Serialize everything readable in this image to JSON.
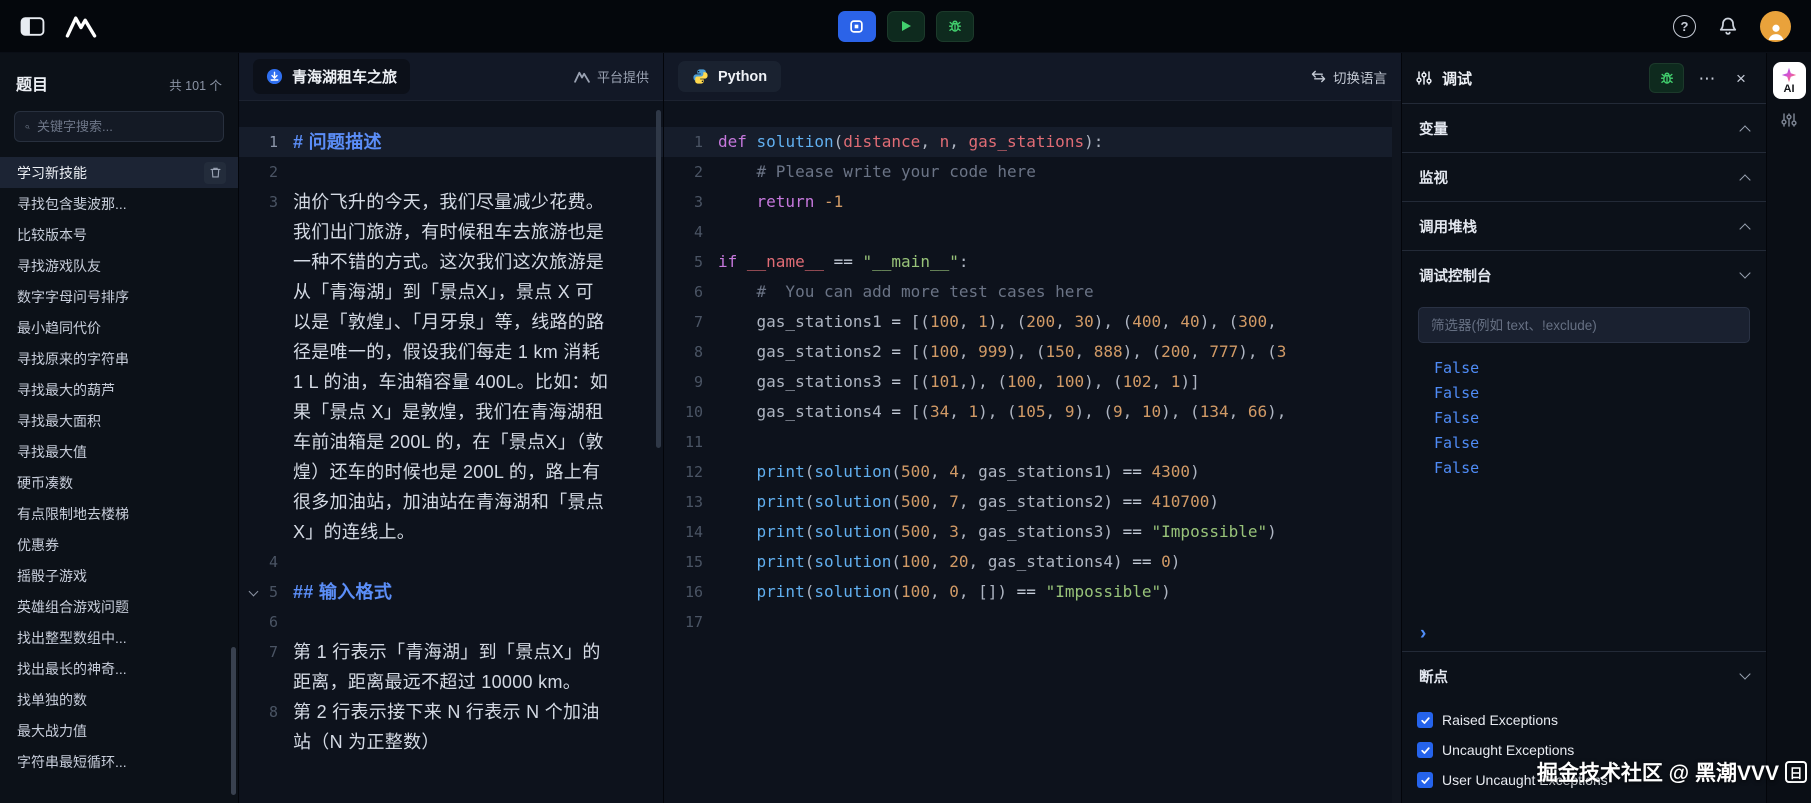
{
  "topbar": {
    "help": "?"
  },
  "sidebar": {
    "title": "题目",
    "count": "共 101 个",
    "search_placeholder": "关键字搜索...",
    "items": [
      {
        "label": "学习新技能",
        "active": true
      },
      {
        "label": "寻找包含斐波那..."
      },
      {
        "label": "比较版本号"
      },
      {
        "label": "寻找游戏队友"
      },
      {
        "label": "数字字母问号排序"
      },
      {
        "label": "最小趋同代价"
      },
      {
        "label": "寻找原来的字符串"
      },
      {
        "label": "寻找最大的葫芦"
      },
      {
        "label": "寻找最大面积"
      },
      {
        "label": "寻找最大值"
      },
      {
        "label": "硬币凑数"
      },
      {
        "label": "有点限制地去楼梯"
      },
      {
        "label": "优惠券"
      },
      {
        "label": "摇骰子游戏"
      },
      {
        "label": "英雄组合游戏问题"
      },
      {
        "label": "找出整型数组中..."
      },
      {
        "label": "找出最长的神奇..."
      },
      {
        "label": "找单独的数"
      },
      {
        "label": "最大战力值"
      },
      {
        "label": "字符串最短循环..."
      }
    ]
  },
  "problem": {
    "title": "青海湖租车之旅",
    "provider": "平台提供",
    "lines": [
      {
        "n": "1",
        "style": "heading",
        "highlight": true,
        "text": "# 问题描述"
      },
      {
        "n": "2",
        "style": "blank",
        "text": ""
      },
      {
        "n": "3",
        "style": "text",
        "text": "油价飞升的今天，我们尽量减少花费。我们出门旅游，有时候租车去旅游也是一种不错的方式。这次我们这次旅游是从「青海湖」到「景点X」，景点 X 可以是「敦煌」、「月牙泉」等，线路的路径是唯一的，假设我们每走 1 km 消耗 1 L 的油，车油箱容量 400L。比如：如果「景点 X」是敦煌，我们在青海湖租车前油箱是 200L 的，在「景点X」（敦煌）还车的时候也是 200L 的，路上有很多加油站，加油站在青海湖和「景点 X」的连线上。"
      },
      {
        "n": "4",
        "style": "blank",
        "text": ""
      },
      {
        "n": "5",
        "style": "heading",
        "chevron": true,
        "text": "## 输入格式"
      },
      {
        "n": "6",
        "style": "blank",
        "text": ""
      },
      {
        "n": "7",
        "style": "text",
        "text": "第 1 行表示「青海湖」到「景点X」的距离，距离最远不超过 10000 km。"
      },
      {
        "n": "8",
        "style": "text",
        "text": "第 2 行表示接下来 N 行表示 N 个加油站（N 为正整数）"
      }
    ]
  },
  "editor": {
    "language": "Python",
    "switch_label": "切换语言",
    "lines": [
      {
        "n": "1",
        "highlight": true,
        "tokens": [
          [
            "k",
            "def"
          ],
          [
            "t",
            " "
          ],
          [
            "f",
            "solution"
          ],
          [
            "t",
            "("
          ],
          [
            "p",
            "distance"
          ],
          [
            "t",
            ", "
          ],
          [
            "p",
            "n"
          ],
          [
            "t",
            ", "
          ],
          [
            "p",
            "gas_stations"
          ],
          [
            "t",
            "):"
          ]
        ]
      },
      {
        "n": "2",
        "tokens": [
          [
            "c",
            "    # Please write your code here"
          ]
        ]
      },
      {
        "n": "3",
        "tokens": [
          [
            "t",
            "    "
          ],
          [
            "k",
            "return"
          ],
          [
            "t",
            " "
          ],
          [
            "n",
            "-1"
          ]
        ]
      },
      {
        "n": "4",
        "tokens": []
      },
      {
        "n": "5",
        "tokens": [
          [
            "k",
            "if"
          ],
          [
            "t",
            " "
          ],
          [
            "p",
            "__name__"
          ],
          [
            "t",
            " "
          ],
          [
            "o",
            "=="
          ],
          [
            "t",
            " "
          ],
          [
            "s",
            "\"__main__\""
          ],
          [
            "t",
            ":"
          ]
        ]
      },
      {
        "n": "6",
        "tokens": [
          [
            "c",
            "    #  You can add more test cases here"
          ]
        ]
      },
      {
        "n": "7",
        "tokens": [
          [
            "t",
            "    gas_stations1 "
          ],
          [
            "o",
            "="
          ],
          [
            "t",
            " [("
          ],
          [
            "n",
            "100"
          ],
          [
            "t",
            ", "
          ],
          [
            "n",
            "1"
          ],
          [
            "t",
            "), ("
          ],
          [
            "n",
            "200"
          ],
          [
            "t",
            ", "
          ],
          [
            "n",
            "30"
          ],
          [
            "t",
            "), ("
          ],
          [
            "n",
            "400"
          ],
          [
            "t",
            ", "
          ],
          [
            "n",
            "40"
          ],
          [
            "t",
            "), ("
          ],
          [
            "n",
            "300"
          ],
          [
            "t",
            ","
          ]
        ]
      },
      {
        "n": "8",
        "tokens": [
          [
            "t",
            "    gas_stations2 "
          ],
          [
            "o",
            "="
          ],
          [
            "t",
            " [("
          ],
          [
            "n",
            "100"
          ],
          [
            "t",
            ", "
          ],
          [
            "n",
            "999"
          ],
          [
            "t",
            "), ("
          ],
          [
            "n",
            "150"
          ],
          [
            "t",
            ", "
          ],
          [
            "n",
            "888"
          ],
          [
            "t",
            "), ("
          ],
          [
            "n",
            "200"
          ],
          [
            "t",
            ", "
          ],
          [
            "n",
            "777"
          ],
          [
            "t",
            "), ("
          ],
          [
            "n",
            "3"
          ]
        ]
      },
      {
        "n": "9",
        "tokens": [
          [
            "t",
            "    gas_stations3 "
          ],
          [
            "o",
            "="
          ],
          [
            "t",
            " [("
          ],
          [
            "n",
            "101"
          ],
          [
            "t",
            ",), ("
          ],
          [
            "n",
            "100"
          ],
          [
            "t",
            ", "
          ],
          [
            "n",
            "100"
          ],
          [
            "t",
            "), ("
          ],
          [
            "n",
            "102"
          ],
          [
            "t",
            ", "
          ],
          [
            "n",
            "1"
          ],
          [
            "t",
            ")]"
          ]
        ]
      },
      {
        "n": "10",
        "tokens": [
          [
            "t",
            "    gas_stations4 "
          ],
          [
            "o",
            "="
          ],
          [
            "t",
            " [("
          ],
          [
            "n",
            "34"
          ],
          [
            "t",
            ", "
          ],
          [
            "n",
            "1"
          ],
          [
            "t",
            "), ("
          ],
          [
            "n",
            "105"
          ],
          [
            "t",
            ", "
          ],
          [
            "n",
            "9"
          ],
          [
            "t",
            "), ("
          ],
          [
            "n",
            "9"
          ],
          [
            "t",
            ", "
          ],
          [
            "n",
            "10"
          ],
          [
            "t",
            "), ("
          ],
          [
            "n",
            "134"
          ],
          [
            "t",
            ", "
          ],
          [
            "n",
            "66"
          ],
          [
            "t",
            "),"
          ]
        ]
      },
      {
        "n": "11",
        "tokens": []
      },
      {
        "n": "12",
        "tokens": [
          [
            "t",
            "    "
          ],
          [
            "f",
            "print"
          ],
          [
            "t",
            "("
          ],
          [
            "f",
            "solution"
          ],
          [
            "t",
            "("
          ],
          [
            "n",
            "500"
          ],
          [
            "t",
            ", "
          ],
          [
            "n",
            "4"
          ],
          [
            "t",
            ", gas_stations1) "
          ],
          [
            "o",
            "=="
          ],
          [
            "t",
            " "
          ],
          [
            "n",
            "4300"
          ],
          [
            "t",
            ")"
          ]
        ]
      },
      {
        "n": "13",
        "tokens": [
          [
            "t",
            "    "
          ],
          [
            "f",
            "print"
          ],
          [
            "t",
            "("
          ],
          [
            "f",
            "solution"
          ],
          [
            "t",
            "("
          ],
          [
            "n",
            "500"
          ],
          [
            "t",
            ", "
          ],
          [
            "n",
            "7"
          ],
          [
            "t",
            ", gas_stations2) "
          ],
          [
            "o",
            "=="
          ],
          [
            "t",
            " "
          ],
          [
            "n",
            "410700"
          ],
          [
            "t",
            ")"
          ]
        ]
      },
      {
        "n": "14",
        "tokens": [
          [
            "t",
            "    "
          ],
          [
            "f",
            "print"
          ],
          [
            "t",
            "("
          ],
          [
            "f",
            "solution"
          ],
          [
            "t",
            "("
          ],
          [
            "n",
            "500"
          ],
          [
            "t",
            ", "
          ],
          [
            "n",
            "3"
          ],
          [
            "t",
            ", gas_stations3) "
          ],
          [
            "o",
            "=="
          ],
          [
            "t",
            " "
          ],
          [
            "s",
            "\"Impossible\""
          ],
          [
            "t",
            ")"
          ]
        ]
      },
      {
        "n": "15",
        "tokens": [
          [
            "t",
            "    "
          ],
          [
            "f",
            "print"
          ],
          [
            "t",
            "("
          ],
          [
            "f",
            "solution"
          ],
          [
            "t",
            "("
          ],
          [
            "n",
            "100"
          ],
          [
            "t",
            ", "
          ],
          [
            "n",
            "20"
          ],
          [
            "t",
            ", gas_stations4) "
          ],
          [
            "o",
            "=="
          ],
          [
            "t",
            " "
          ],
          [
            "n",
            "0"
          ],
          [
            "t",
            ")"
          ]
        ]
      },
      {
        "n": "16",
        "tokens": [
          [
            "t",
            "    "
          ],
          [
            "f",
            "print"
          ],
          [
            "t",
            "("
          ],
          [
            "f",
            "solution"
          ],
          [
            "t",
            "("
          ],
          [
            "n",
            "100"
          ],
          [
            "t",
            ", "
          ],
          [
            "n",
            "0"
          ],
          [
            "t",
            ", []) "
          ],
          [
            "o",
            "=="
          ],
          [
            "t",
            " "
          ],
          [
            "s",
            "\"Impossible\""
          ],
          [
            "t",
            ")"
          ]
        ]
      },
      {
        "n": "17",
        "tokens": []
      }
    ]
  },
  "debug": {
    "title": "调试",
    "more": "⋯",
    "close": "×",
    "prompt": "›",
    "sections": [
      {
        "label": "变量",
        "collapsed": true
      },
      {
        "label": "监视",
        "collapsed": true
      },
      {
        "label": "调用堆栈",
        "collapsed": true
      },
      {
        "label": "调试控制台",
        "collapsed": false
      }
    ],
    "filter_placeholder": "筛选器(例如 text、!exclude)",
    "console_output": [
      "False",
      "False",
      "False",
      "False",
      "False"
    ],
    "breakpoints": {
      "label": "断点",
      "items": [
        {
          "label": "Raised Exceptions",
          "checked": true
        },
        {
          "label": "Uncaught Exceptions",
          "checked": true
        },
        {
          "label": "User Uncaught Exceptions",
          "checked": true
        }
      ]
    }
  },
  "rail": {
    "ai_label": "AI"
  },
  "watermark": {
    "text": "掘金技术社区 @ 黑潮VVV",
    "badge": "日"
  }
}
